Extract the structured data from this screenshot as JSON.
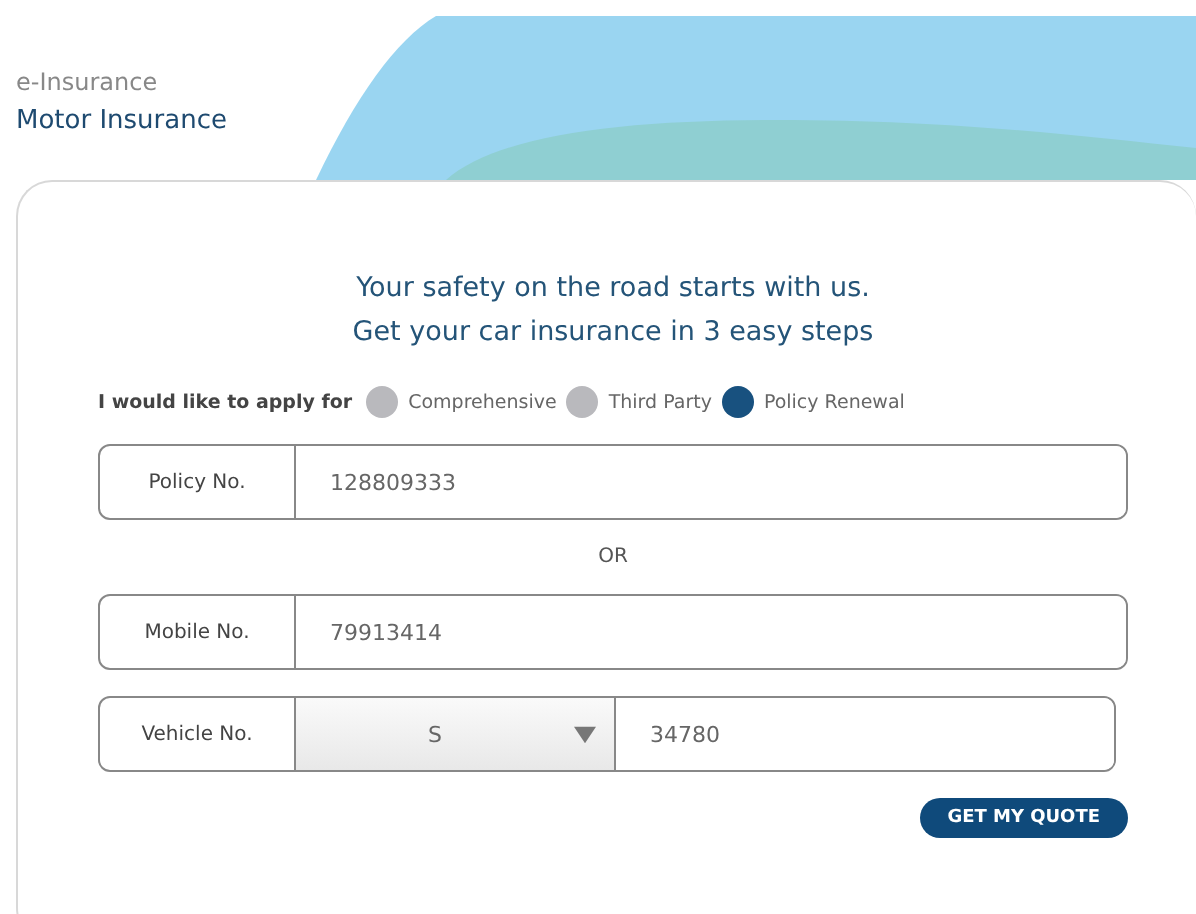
{
  "header": {
    "section": "e-Insurance",
    "title": "Motor Insurance"
  },
  "headline": [
    "Your safety on the road starts with us.",
    "Get your car insurance in 3 easy steps"
  ],
  "apply_for": {
    "label": "I would like to apply for",
    "options": [
      {
        "label": "Comprehensive",
        "selected": false
      },
      {
        "label": "Third Party",
        "selected": false
      },
      {
        "label": "Policy Renewal",
        "selected": true
      }
    ]
  },
  "policy_field": {
    "label": "Policy No.",
    "value": "128809333"
  },
  "separator": "OR",
  "mobile_field": {
    "label": "Mobile No.",
    "value": "79913414"
  },
  "vehicle_field": {
    "label": "Vehicle No.",
    "prefix": "S",
    "value": "34780"
  },
  "submit_button": "GET MY QUOTE"
}
